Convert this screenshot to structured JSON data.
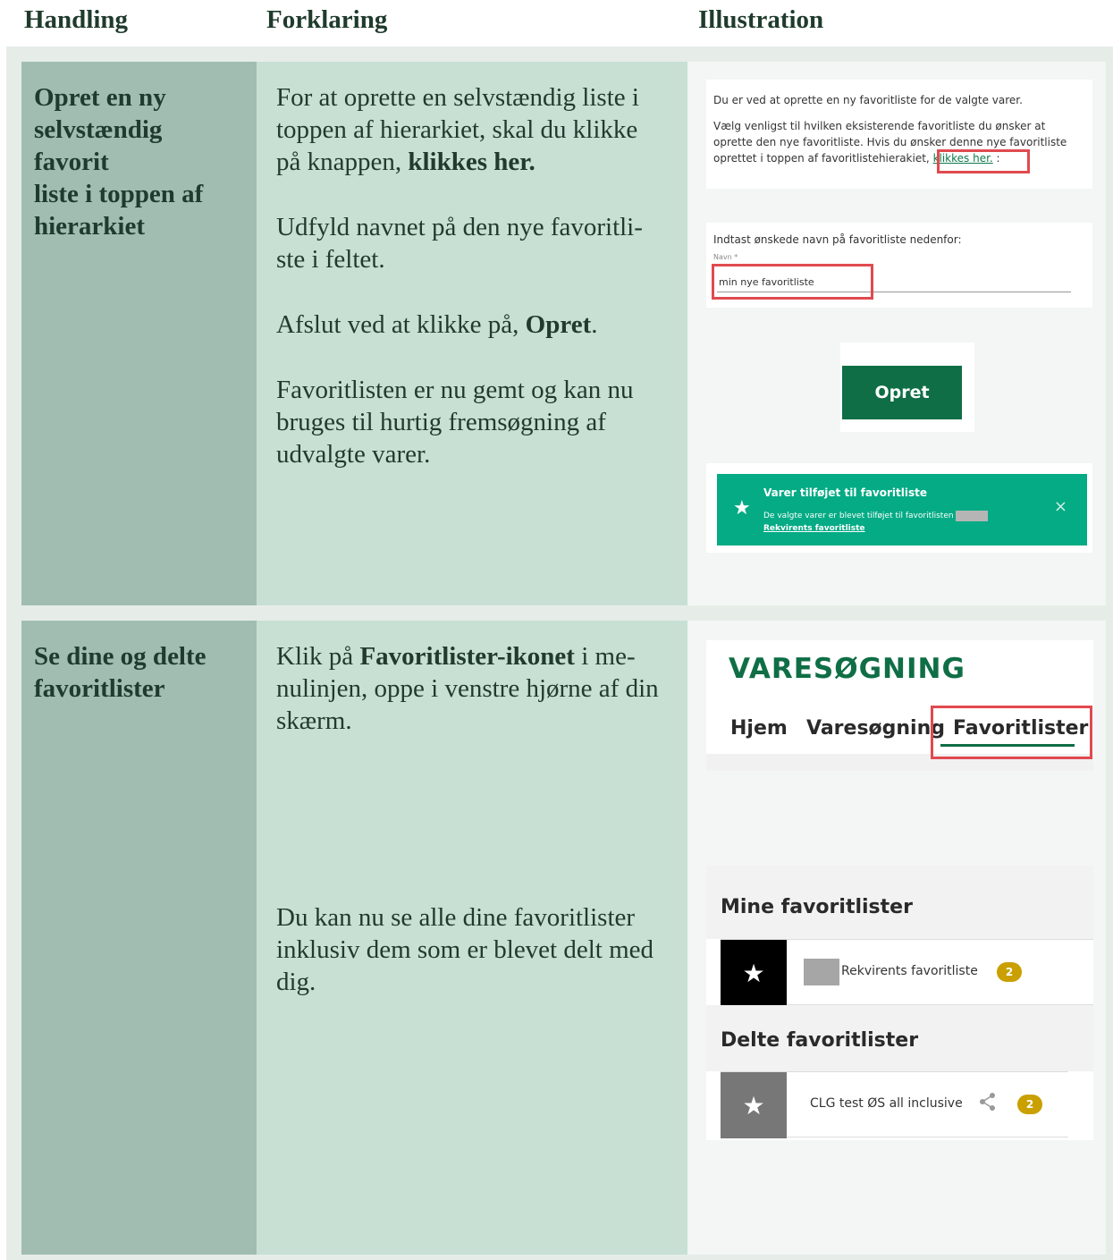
{
  "header": {
    "col1": "Handling",
    "col2": "Forklaring",
    "col3": "Illustration"
  },
  "rows": [
    {
      "handling": "Opret en ny\nselvstændig\nfavorit\nliste i toppen af\nhierarkiet",
      "paragraphs": [
        {
          "pre": "For at oprette en selvstændig liste i toppen af hierarkiet, skal du klikke på knappen, ",
          "bold": "klikkes her.",
          "post": ""
        },
        {
          "pre": "Udfyld navnet på den nye favoritli-ste i feltet.",
          "bold": "",
          "post": ""
        },
        {
          "pre": "Afslut ved at klikke på, ",
          "bold": "Opret",
          "post": "."
        },
        {
          "pre": "Favoritlisten er nu gemt og kan nu bruges til hurtig fremsøgning af udvalgte varer.",
          "bold": "",
          "post": ""
        }
      ],
      "illustration": {
        "intro": "Du er ved at oprette en ny favoritliste for de valgte varer.",
        "choose": "Vælg venligst til hvilken eksisterende favoritliste du ønsker at oprette den nye favoritliste. Hvis du ønsker denne nye favoritliste oprettet i toppen af favoritlistehierakiet, ",
        "link": "klikkes her.",
        "link_after": " :",
        "name_prompt": "Indtast ønskede navn på favoritliste nedenfor:",
        "field_label": "Navn *",
        "field_value": "min nye favoritliste",
        "button": "Opret",
        "toast_title": "Varer tilføjet til favoritliste",
        "toast_body": "De valgte varer er blevet tilføjet til favoritlisten",
        "toast_link": "Rekvirents favoritliste",
        "toast_close": "×",
        "toast_icon": "★"
      }
    },
    {
      "handling": "Se dine og delte\nfavoritlister",
      "paragraphs": [
        {
          "pre": "Klik på ",
          "bold": "Favoritlister-ikonet",
          "post": " i me-nulinjen, oppe i venstre hjørne af din skærm."
        },
        {
          "pre": "Du kan nu se alle dine favoritlister inklusiv dem som er blevet delt med dig.",
          "bold": "",
          "post": ""
        }
      ],
      "illustration": {
        "brand": "VARESØGNING",
        "tabs": [
          "Hjem",
          "Varesøgning",
          "Favoritlister"
        ],
        "mine_title": "Mine favoritlister",
        "mine_item": "Rekvirents favoritliste",
        "mine_count": "2",
        "shared_title": "Delte favoritlister",
        "shared_item": "CLG test ØS all inclusive",
        "shared_count": "2",
        "star_icon": "★",
        "share_icon": "share-icon"
      }
    }
  ],
  "colors": {
    "handling_bg": "#a1bdb1",
    "forklaring_bg": "#c8e0d4",
    "accent_green": "#0f6e45",
    "toast_green": "#04ab85",
    "highlight_red": "#e04a4f",
    "badge_gold": "#c9a000"
  }
}
